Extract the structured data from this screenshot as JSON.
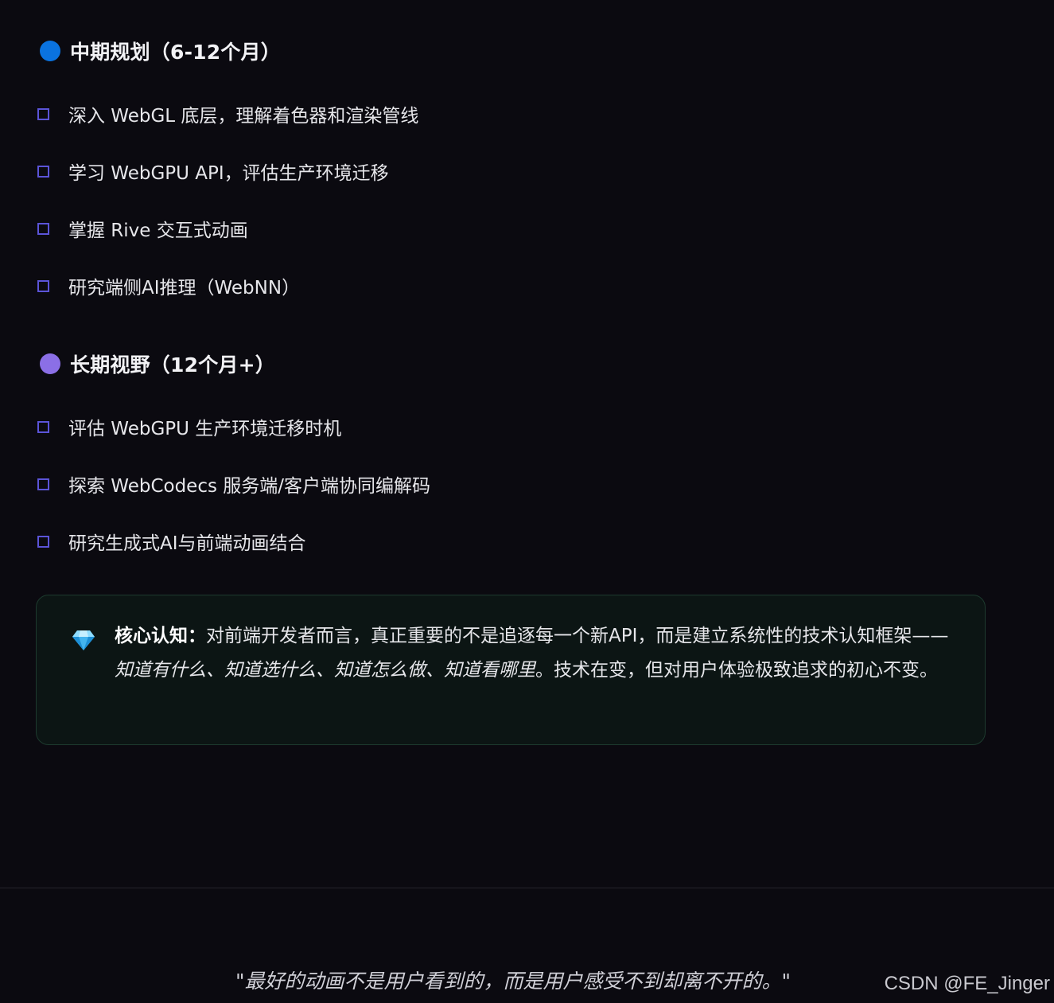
{
  "sections": [
    {
      "title": "中期规划（6-12个月）",
      "dot_color": "#0a73e0",
      "items": [
        "深入 WebGL 底层，理解着色器和渲染管线",
        "学习 WebGPU API，评估生产环境迁移",
        "掌握 Rive 交互式动画",
        "研究端侧AI推理（WebNN）"
      ]
    },
    {
      "title": "长期视野（12个月+）",
      "dot_color": "#8b6fe6",
      "items": [
        "评估 WebGPU 生产环境迁移时机",
        "探索 WebCodecs 服务端/客户端协同编解码",
        "研究生成式AI与前端动画结合"
      ]
    }
  ],
  "callout": {
    "icon": "diamond-icon",
    "label": "核心认知：",
    "text_before": "对前端开发者而言，真正重要的不是追逐每一个新API，而是建立系统性的技术认知框架——",
    "text_em": "知道有什么、知道选什么、知道怎么做、知道看哪里",
    "text_after": "。技术在变，但对用户体验极致追求的初心不变。"
  },
  "quote": "\"最好的动画不是用户看到的，而是用户感受不到却离不开的。\"",
  "watermark": "CSDN @FE_Jinger",
  "colors": {
    "background": "#0b0a10",
    "checkbox_border": "#5b54d8",
    "callout_bg": "#0c1514",
    "callout_border": "#1d3a2e"
  }
}
